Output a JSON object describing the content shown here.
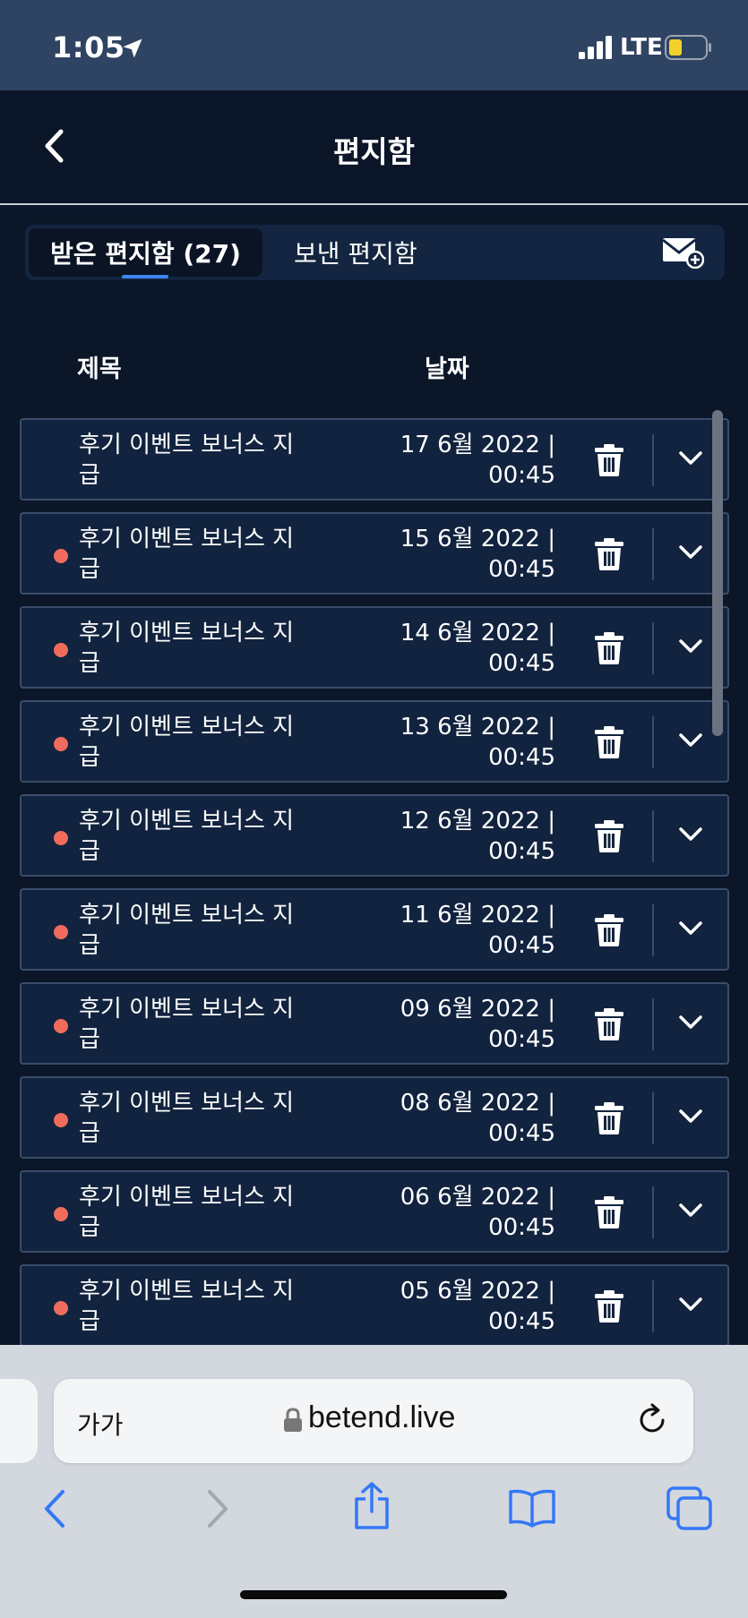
{
  "status_bar": {
    "time": "1:05",
    "network": "LTE"
  },
  "header": {
    "title": "편지함"
  },
  "tabs": {
    "inbox_label": "받은 편지함 (27)",
    "sent_label": "보낸 편지함"
  },
  "columns": {
    "subject": "제목",
    "date": "날짜"
  },
  "messages": [
    {
      "subject": "후기 이벤트 보너스 지급",
      "date": "17 6월 2022 |",
      "time": "00:45",
      "unread": false
    },
    {
      "subject": "후기 이벤트 보너스 지급",
      "date": "15 6월 2022 |",
      "time": "00:45",
      "unread": true
    },
    {
      "subject": "후기 이벤트 보너스 지급",
      "date": "14 6월 2022 |",
      "time": "00:45",
      "unread": true
    },
    {
      "subject": "후기 이벤트 보너스 지급",
      "date": "13 6월 2022 |",
      "time": "00:45",
      "unread": true
    },
    {
      "subject": "후기 이벤트 보너스 지급",
      "date": "12 6월 2022 |",
      "time": "00:45",
      "unread": true
    },
    {
      "subject": "후기 이벤트 보너스 지급",
      "date": "11 6월 2022 |",
      "time": "00:45",
      "unread": true
    },
    {
      "subject": "후기 이벤트 보너스 지급",
      "date": "09 6월 2022 |",
      "time": "00:45",
      "unread": true
    },
    {
      "subject": "후기 이벤트 보너스 지급",
      "date": "08 6월 2022 |",
      "time": "00:45",
      "unread": true
    },
    {
      "subject": "후기 이벤트 보너스 지급",
      "date": "06 6월 2022 |",
      "time": "00:45",
      "unread": true
    },
    {
      "subject": "후기 이벤트 보너스 지급",
      "date": "05 6월 2022 |",
      "time": "00:45",
      "unread": true
    }
  ],
  "browser": {
    "text_size_label": "가가",
    "url": "betend.live"
  },
  "colors": {
    "background": "#0b1628",
    "row": "#11233e",
    "unread_dot": "#ef6c5d",
    "accent": "#3b86f0",
    "safari_blue": "#3478f6"
  },
  "icons": [
    "location-arrow-icon",
    "signal-icon",
    "battery-icon",
    "back-chevron-icon",
    "compose-mail-icon",
    "trash-icon",
    "chevron-down-icon",
    "lock-icon",
    "reload-icon",
    "share-icon",
    "bookmarks-icon",
    "tabs-icon"
  ]
}
